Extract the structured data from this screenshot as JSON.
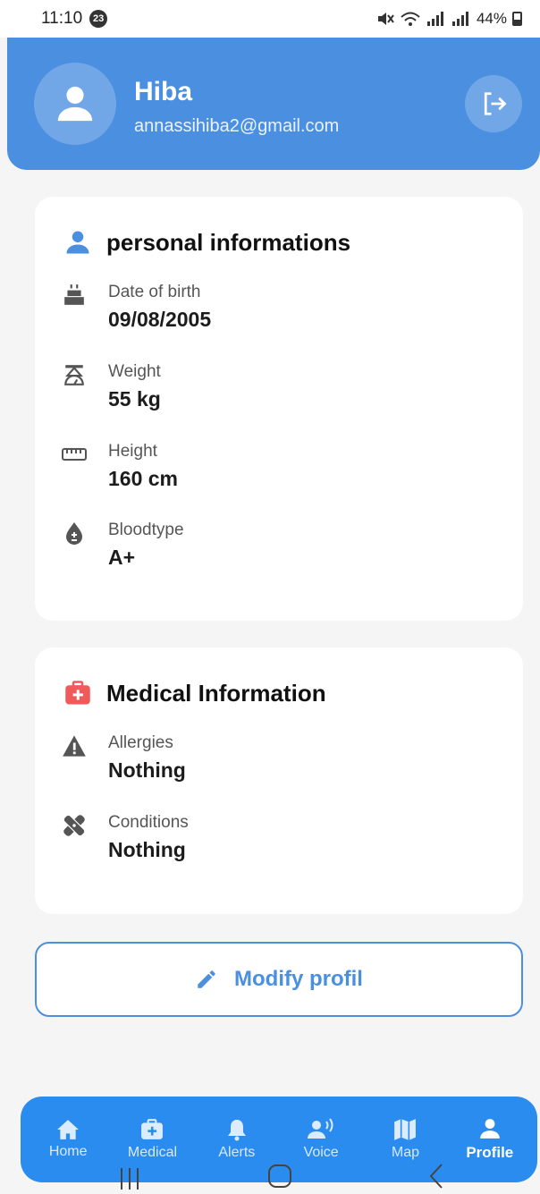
{
  "status_bar": {
    "time": "11:10",
    "notification_count": "23",
    "battery": "44%"
  },
  "header": {
    "name": "Hiba",
    "email": "annassihiba2@gmail.com"
  },
  "personal": {
    "title": "personal informations",
    "fields": [
      {
        "label": "Date of birth",
        "value": "09/08/2005",
        "icon": "cake-icon"
      },
      {
        "label": "Weight",
        "value": "55 kg",
        "icon": "scale-icon"
      },
      {
        "label": "Height",
        "value": "160 cm",
        "icon": "ruler-icon"
      },
      {
        "label": "Bloodtype",
        "value": "A+",
        "icon": "blood-drop-icon"
      }
    ]
  },
  "medical": {
    "title": "Medical Information",
    "fields": [
      {
        "label": "Allergies",
        "value": "Nothing",
        "icon": "warning-icon"
      },
      {
        "label": "Conditions",
        "value": "Nothing",
        "icon": "bandage-icon"
      }
    ]
  },
  "modify_button": {
    "label": "Modify profil"
  },
  "bottom_nav": {
    "items": [
      {
        "label": "Home",
        "icon": "home-icon"
      },
      {
        "label": "Medical",
        "icon": "medical-kit-icon"
      },
      {
        "label": "Alerts",
        "icon": "bell-icon"
      },
      {
        "label": "Voice",
        "icon": "voice-icon"
      },
      {
        "label": "Map",
        "icon": "map-icon"
      },
      {
        "label": "Profile",
        "icon": "person-icon"
      }
    ],
    "active": "Profile"
  },
  "colors": {
    "primary": "#4a8fe0",
    "nav_bg": "#2b8cf0",
    "medical_red": "#f05a5a",
    "background": "#f5f5f5"
  }
}
